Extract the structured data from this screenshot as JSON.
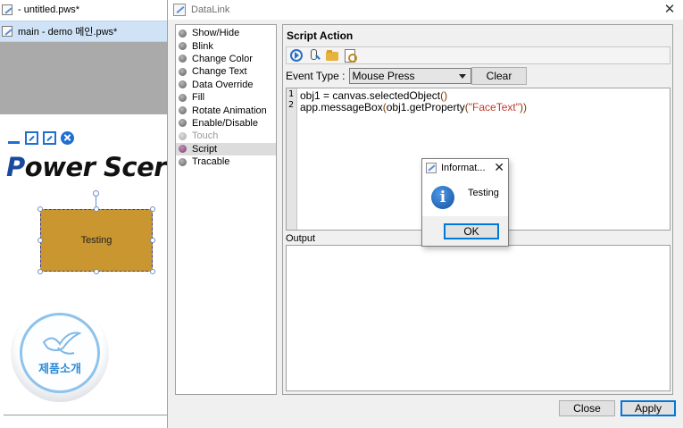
{
  "background": {
    "tabs": [
      {
        "label": "- untitled.pws*"
      },
      {
        "label": "main - demo 메인.pws*"
      }
    ],
    "logo_text_first": "P",
    "logo_text_rest": "ower Scer",
    "shape_label": "Testing",
    "circle_label": "제품소개"
  },
  "dialog": {
    "title": "DataLink",
    "actions": [
      {
        "label": "Show/Hide",
        "state": "normal"
      },
      {
        "label": "Blink",
        "state": "normal"
      },
      {
        "label": "Change Color",
        "state": "normal"
      },
      {
        "label": "Change Text",
        "state": "normal"
      },
      {
        "label": "Data Override",
        "state": "normal"
      },
      {
        "label": "Fill",
        "state": "normal"
      },
      {
        "label": "Rotate Animation",
        "state": "normal"
      },
      {
        "label": "Enable/Disable",
        "state": "normal"
      },
      {
        "label": "Touch",
        "state": "disabled"
      },
      {
        "label": "Script",
        "state": "selected"
      },
      {
        "label": "Tracable",
        "state": "normal"
      }
    ],
    "panel_title": "Script Action",
    "event_type_label": "Event Type :",
    "event_type_value": "Mouse Press",
    "clear_label": "Clear",
    "code": {
      "line_numbers": [
        "1",
        "2"
      ],
      "line1": {
        "a": "obj1 = canvas.selectedObject",
        "b": "()"
      },
      "line2": {
        "a": "app.messageBox",
        "b": "(",
        "c": "obj1.getProperty",
        "d": "(",
        "e": "\"FaceText\"",
        "f": "))"
      }
    },
    "output_label": "Output",
    "close_label": "Close",
    "apply_label": "Apply"
  },
  "messagebox": {
    "title": "Informat...",
    "close_glyph": "✕",
    "icon_glyph": "i",
    "text": "Testing",
    "ok_label": "OK"
  },
  "colors": {
    "accent": "#0078d7",
    "shape_fill": "#c9962f",
    "selected_tab": "#cfe2f6",
    "string_literal": "#c0392b"
  },
  "icons": [
    "file-icon",
    "minimize-icon",
    "restore-icon",
    "maximize-icon",
    "close-circle-icon",
    "run-icon",
    "debug-icon",
    "open-folder-icon",
    "find-icon",
    "info-icon"
  ]
}
